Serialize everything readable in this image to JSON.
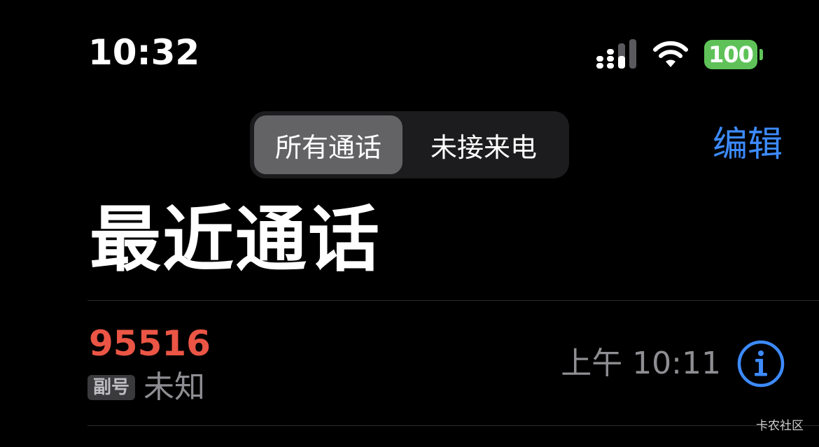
{
  "status_bar": {
    "time": "10:32",
    "battery_level": "100",
    "signal_icon": "cellular-signal-icon",
    "wifi_icon": "wifi-icon",
    "battery_color": "#5ec258"
  },
  "segmented_control": {
    "items": [
      {
        "label": "所有通话",
        "selected": true
      },
      {
        "label": "未接来电",
        "selected": false
      }
    ]
  },
  "header": {
    "edit_label": "编辑",
    "title": "最近通话",
    "accent_color": "#3d8bff"
  },
  "calls": [
    {
      "number": "95516",
      "missed": true,
      "line_badge": "副号",
      "type": "未知",
      "time": "上午 10:11",
      "info_icon": "info-icon"
    }
  ],
  "watermark": "卡农社区"
}
